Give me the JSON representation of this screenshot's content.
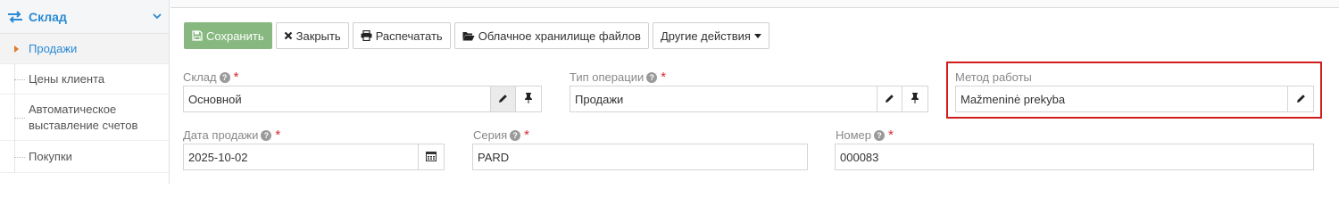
{
  "sidebar": {
    "title": "Склад",
    "items": [
      {
        "label": "Продажи",
        "active": true
      },
      {
        "label": "Цены клиента"
      },
      {
        "label": "Автоматическое выставление счетов"
      },
      {
        "label": "Покупки"
      }
    ]
  },
  "toolbar": {
    "save": "Сохранить",
    "close": "Закрыть",
    "print": "Распечатать",
    "cloud": "Облачное хранилище файлов",
    "other": "Другие действия"
  },
  "form": {
    "warehouse": {
      "label": "Склад",
      "value": "Основной"
    },
    "operation_type": {
      "label": "Тип операции",
      "value": "Продажи"
    },
    "work_method": {
      "label": "Метод работы",
      "value": "Mažmeninė prekyba"
    },
    "sale_date": {
      "label": "Дата продажи",
      "value": "2025-10-02"
    },
    "series": {
      "label": "Серия",
      "value": "PARD"
    },
    "number": {
      "label": "Номер",
      "value": "000083"
    }
  },
  "colors": {
    "accent": "#2a8ad3",
    "save_button": "#87b87f",
    "required": "#d42b2b",
    "highlight": "#d01c1c"
  }
}
